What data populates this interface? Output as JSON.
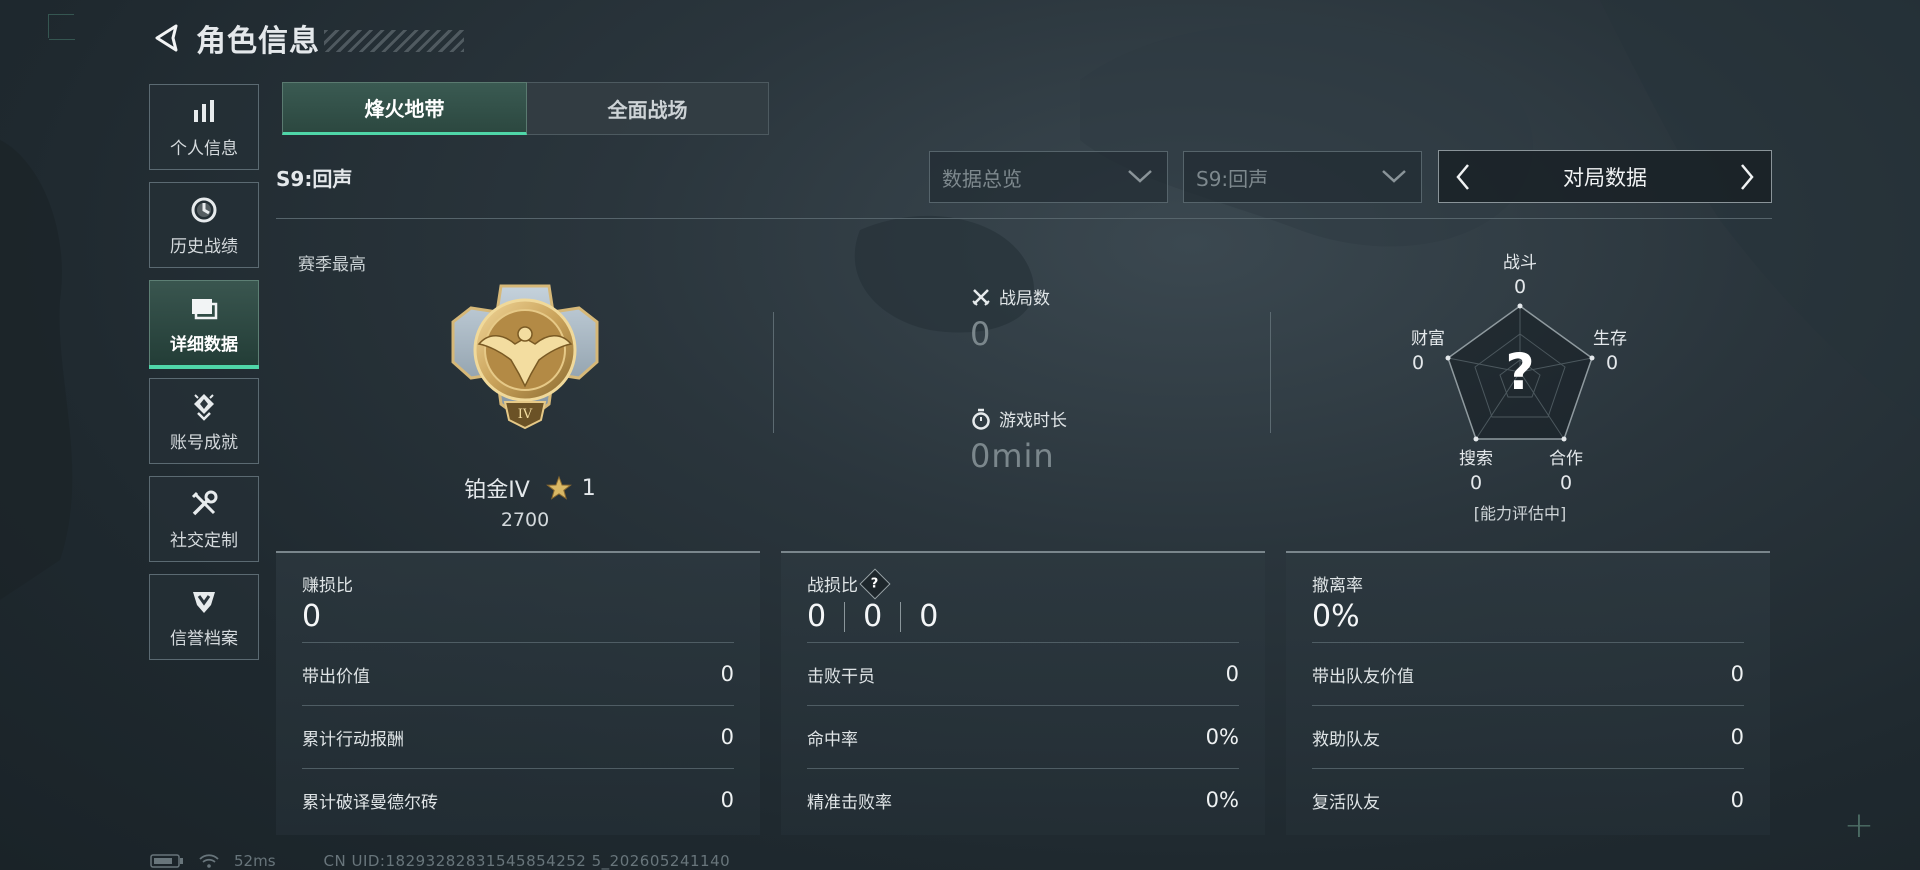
{
  "header": {
    "title": "角色信息"
  },
  "sidebar": {
    "items": [
      {
        "label": "个人信息",
        "icon": "bar-chart-icon"
      },
      {
        "label": "历史战绩",
        "icon": "history-clock-icon"
      },
      {
        "label": "详细数据",
        "icon": "folder-icon",
        "active": true
      },
      {
        "label": "账号成就",
        "icon": "achievement-icon"
      },
      {
        "label": "社交定制",
        "icon": "tools-icon"
      },
      {
        "label": "信誉档案",
        "icon": "shield-emblem-icon"
      }
    ]
  },
  "mode_tabs": [
    {
      "label": "烽火地带",
      "active": true
    },
    {
      "label": "全面战场",
      "active": false
    }
  ],
  "season": {
    "label": "S9:回声",
    "filter1": "数据总览",
    "filter2": "S9:回声",
    "pager_label": "对局数据"
  },
  "summary": {
    "best_label": "赛季最高",
    "rank_name": "铂金IV",
    "rank_stars": "1",
    "rank_score": "2700",
    "matches_label": "战局数",
    "matches_value": "0",
    "playtime_label": "游戏时长",
    "playtime_value": "0min"
  },
  "radar": {
    "axes": [
      {
        "label": "战斗",
        "value": "0"
      },
      {
        "label": "生存",
        "value": "0"
      },
      {
        "label": "合作",
        "value": "0"
      },
      {
        "label": "搜索",
        "value": "0"
      },
      {
        "label": "财富",
        "value": "0"
      }
    ],
    "center_symbol": "?",
    "status": "[能力评估中]"
  },
  "cards": {
    "profit": {
      "title": "赚损比",
      "value": "0",
      "rows": [
        {
          "label": "带出价值",
          "value": "0"
        },
        {
          "label": "累计行动报酬",
          "value": "0"
        },
        {
          "label": "累计破译曼德尔砖",
          "value": "0"
        }
      ]
    },
    "combat": {
      "title": "战损比",
      "help": "?",
      "kd": [
        "0",
        "0",
        "0"
      ],
      "rows": [
        {
          "label": "击败干员",
          "value": "0"
        },
        {
          "label": "命中率",
          "value": "0%"
        },
        {
          "label": "精准击败率",
          "value": "0%"
        }
      ]
    },
    "extract": {
      "title": "撤离率",
      "value": "0%",
      "rows": [
        {
          "label": "带出队友价值",
          "value": "0"
        },
        {
          "label": "救助队友",
          "value": "0"
        },
        {
          "label": "复活队友",
          "value": "0"
        }
      ]
    }
  },
  "status_bar": {
    "ping": "52ms",
    "uid": "CN UID:18293282831545854252 5_202605241140"
  },
  "colors": {
    "accent": "#4fd6a8",
    "medal_gold": "#c9a25a",
    "star": "#d9b865"
  }
}
